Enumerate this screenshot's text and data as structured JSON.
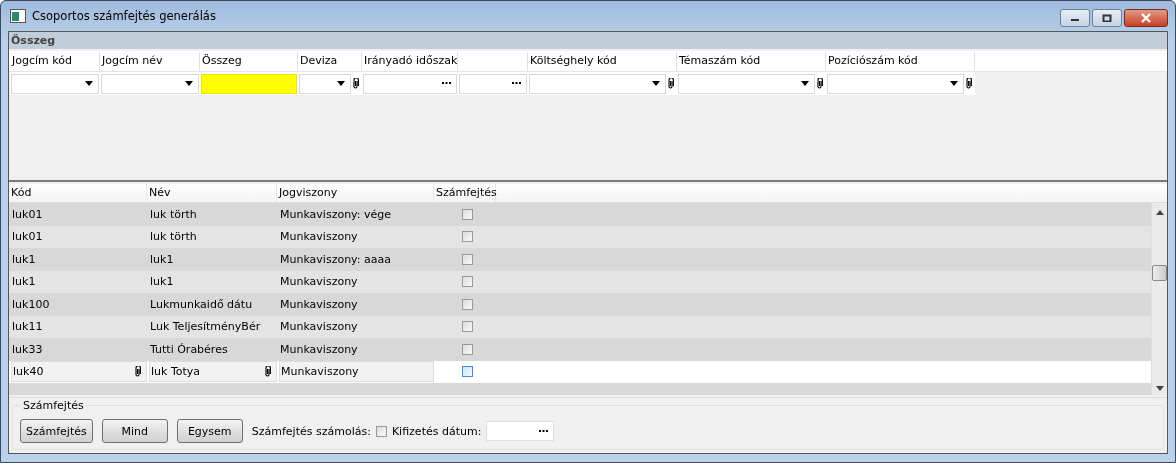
{
  "window": {
    "title": "Csoportos számfejtés generálás"
  },
  "filter_group": {
    "title": "Összeg",
    "columns": [
      {
        "label": "Jogcím kód",
        "kind": "dropdown",
        "attachment": false,
        "required": false
      },
      {
        "label": "Jogcím név",
        "kind": "dropdown",
        "attachment": false,
        "required": false
      },
      {
        "label": "Összeg",
        "kind": "text",
        "attachment": false,
        "required": true
      },
      {
        "label": "Deviza",
        "kind": "dropdown",
        "attachment": true,
        "required": false
      },
      {
        "label": "Irányadó időszak",
        "kind": "picker",
        "attachment": false,
        "required": false
      },
      {
        "kind": "picker",
        "attachment": false,
        "required": false
      },
      {
        "label": "Költséghely kód",
        "kind": "dropdown",
        "attachment": true,
        "required": false
      },
      {
        "label": "Témaszám kód",
        "kind": "dropdown",
        "attachment": true,
        "required": false
      },
      {
        "label": "Pozíciószám kód",
        "kind": "dropdown",
        "attachment": true,
        "required": false
      }
    ]
  },
  "table": {
    "columns": [
      "Kód",
      "Név",
      "Jogviszony",
      "Számfejtés"
    ],
    "rows": [
      {
        "code": "luk01",
        "name": "luk törth",
        "relation": "Munkaviszony: vége",
        "checked": false,
        "selected": false
      },
      {
        "code": "luk01",
        "name": "luk törth",
        "relation": "Munkaviszony",
        "checked": false,
        "selected": false
      },
      {
        "code": "luk1",
        "name": "luk1",
        "relation": "Munkaviszony: aaaa",
        "checked": false,
        "selected": false
      },
      {
        "code": "luk1",
        "name": "luk1",
        "relation": "Munkaviszony",
        "checked": false,
        "selected": false
      },
      {
        "code": "luk100",
        "name": "Lukmunkaidő dátu",
        "relation": "Munkaviszony",
        "checked": false,
        "selected": false
      },
      {
        "code": "luk11",
        "name": "Luk TeljesítményBér",
        "relation": "Munkaviszony",
        "checked": false,
        "selected": false
      },
      {
        "code": "luk33",
        "name": "Tutti Órabéres",
        "relation": "Munkaviszony",
        "checked": false,
        "selected": false
      },
      {
        "code": "luk40",
        "name": "luk Totya",
        "relation": "Munkaviszony",
        "checked": false,
        "selected": true
      }
    ]
  },
  "bottom_group": {
    "title": "Számfejtés",
    "buttons": [
      "Számfejtés",
      "Mind",
      "Egysem"
    ],
    "calc_label": "Számfejtés számolás:",
    "calc_checked": false,
    "date_label": "Kifizetés dátum:"
  }
}
